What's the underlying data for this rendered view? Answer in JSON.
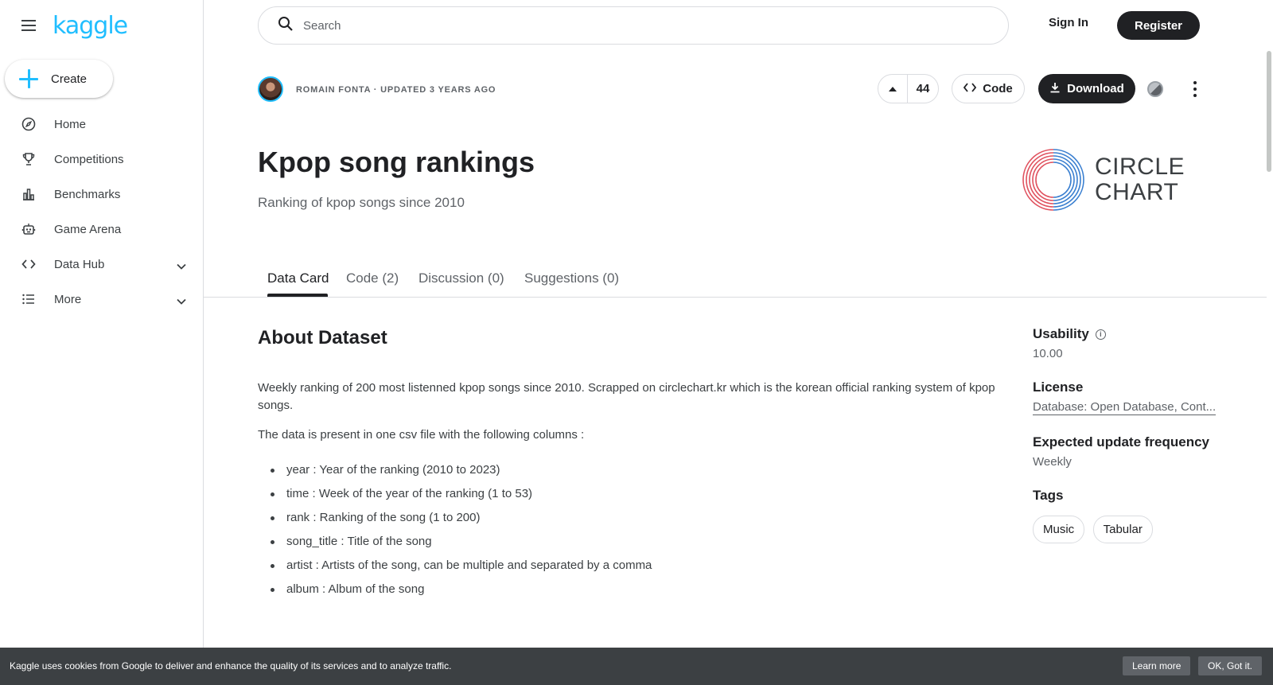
{
  "brand": {
    "logo": "kaggle",
    "accent": "#20beff"
  },
  "sidebar": {
    "create_label": "Create",
    "items": [
      {
        "label": "Home",
        "icon": "compass-icon"
      },
      {
        "label": "Competitions",
        "icon": "trophy-icon"
      },
      {
        "label": "Benchmarks",
        "icon": "bar-chart-icon"
      },
      {
        "label": "Game Arena",
        "icon": "robot-icon"
      },
      {
        "label": "Data Hub",
        "icon": "code-icon"
      },
      {
        "label": "More",
        "icon": "list-icon"
      }
    ]
  },
  "header": {
    "search_placeholder": "Search",
    "signin_label": "Sign In",
    "register_label": "Register"
  },
  "dataset": {
    "author_line": "ROMAIN FONTA · UPDATED 3 YEARS AGO",
    "votes": "44",
    "code_label": "Code",
    "download_label": "Download",
    "title": "Kpop song rankings",
    "subtitle": "Ranking of kpop songs since 2010",
    "cover_text_1": "CIRCLE",
    "cover_text_2": "CHART"
  },
  "tabs": [
    {
      "label": "Data Card",
      "active": true
    },
    {
      "label": "Code (2)"
    },
    {
      "label": "Discussion (0)"
    },
    {
      "label": "Suggestions (0)"
    }
  ],
  "about": {
    "heading": "About Dataset",
    "para1": "Weekly ranking of 200 most listenned kpop songs since 2010. Scrapped on circlechart.kr which is the korean official ranking system of kpop songs.",
    "para2": "The data is present in one csv file with the following columns :",
    "columns": [
      "year : Year of the ranking (2010 to 2023)",
      "time : Week of the year of the ranking (1 to 53)",
      "rank : Ranking of the song (1 to 200)",
      "song_title : Title of the song",
      "artist : Artists of the song, can be multiple and separated by a comma",
      "album : Album of the song"
    ]
  },
  "side": {
    "usability_label": "Usability",
    "usability_value": "10.00",
    "license_label": "License",
    "license_value": "Database: Open Database, Cont...",
    "frequency_label": "Expected update frequency",
    "frequency_value": "Weekly",
    "tags_label": "Tags",
    "tags": [
      "Music",
      "Tabular"
    ]
  },
  "cookie": {
    "message": "Kaggle uses cookies from Google to deliver and enhance the quality of its services and to analyze traffic.",
    "learn_more": "Learn more",
    "ok": "OK, Got it."
  }
}
